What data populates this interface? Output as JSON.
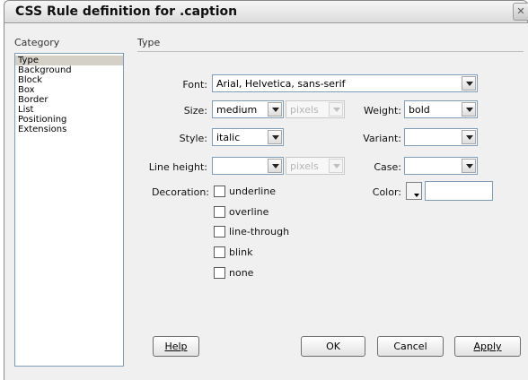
{
  "window": {
    "title": "CSS Rule definition for .caption",
    "close_glyph": "✕"
  },
  "category": {
    "label": "Category",
    "items": [
      "Type",
      "Background",
      "Block",
      "Box",
      "Border",
      "List",
      "Positioning",
      "Extensions"
    ],
    "selected": "Type"
  },
  "panel": {
    "label": "Type"
  },
  "fields": {
    "font": {
      "label": "Font:",
      "value": "Arial, Helvetica, sans-serif"
    },
    "size": {
      "label": "Size:",
      "value": "medium",
      "unit": "pixels"
    },
    "weight": {
      "label": "Weight:",
      "value": "bold"
    },
    "style": {
      "label": "Style:",
      "value": "italic"
    },
    "variant": {
      "label": "Variant:",
      "value": ""
    },
    "line_height": {
      "label": "Line height:",
      "value": "",
      "unit": "pixels"
    },
    "case": {
      "label": "Case:",
      "value": ""
    },
    "decoration": {
      "label": "Decoration:",
      "options": [
        "underline",
        "overline",
        "line-through",
        "blink",
        "none"
      ]
    },
    "color": {
      "label": "Color:",
      "value": ""
    }
  },
  "buttons": {
    "help": "Help",
    "ok": "OK",
    "cancel": "Cancel",
    "apply": "Apply"
  }
}
